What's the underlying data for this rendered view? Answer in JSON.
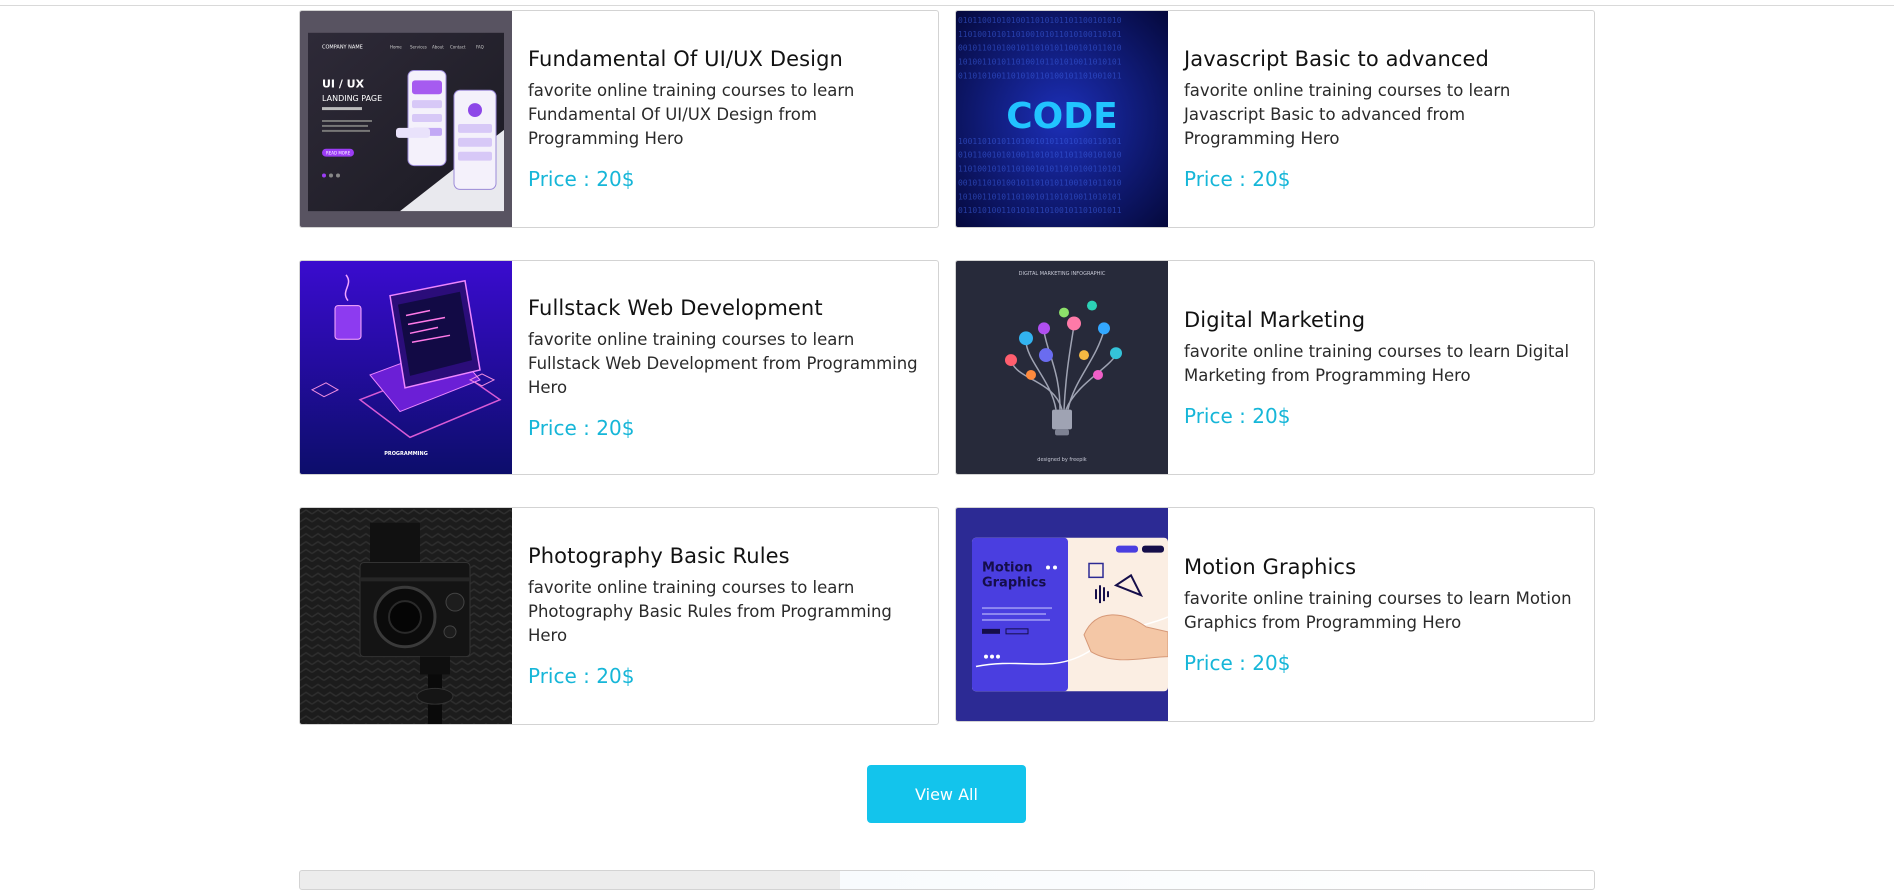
{
  "courses": [
    {
      "title": "Fundamental Of UI/UX Design",
      "desc": "favorite online training courses to learn Fundamental Of UI/UX Design from Programming Hero",
      "price": "Price : 20$",
      "thumb_label": "UI / UX",
      "thumb_sub": "LANDING PAGE",
      "thumb_company": "COMPANY NAME",
      "thumb_button": "READ MORE",
      "thumb_nav": [
        "Home",
        "Services",
        "About",
        "Contact",
        "FAQ"
      ]
    },
    {
      "title": "Javascript Basic to advanced",
      "desc": "favorite online training courses to learn Javascript Basic to advanced from Programming Hero",
      "price": "Price : 20$",
      "thumb_label": "CODE"
    },
    {
      "title": "Fullstack Web Development",
      "desc": "favorite online training courses to learn Fullstack Web Development from Programming Hero",
      "price": "Price : 20$",
      "thumb_label": "PROGRAMMING"
    },
    {
      "title": "Digital Marketing",
      "desc": "favorite online training courses to learn Digital Marketing from Programming Hero",
      "price": "Price : 20$",
      "thumb_label": "DIGITAL MARKETING INFOGRAPHIC",
      "thumb_footer": "designed by freepik"
    },
    {
      "title": "Photography Basic Rules",
      "desc": "favorite online training courses to learn Photography Basic Rules from Programming Hero",
      "price": "Price : 20$"
    },
    {
      "title": "Motion Graphics",
      "desc": "favorite online training courses to learn Motion Graphics from Programming Hero",
      "price": "Price : 20$",
      "thumb_label": "Motion Graphics"
    }
  ],
  "view_all_label": "View All",
  "colors": {
    "accent": "#13c4ec",
    "price": "#16b6d8"
  }
}
